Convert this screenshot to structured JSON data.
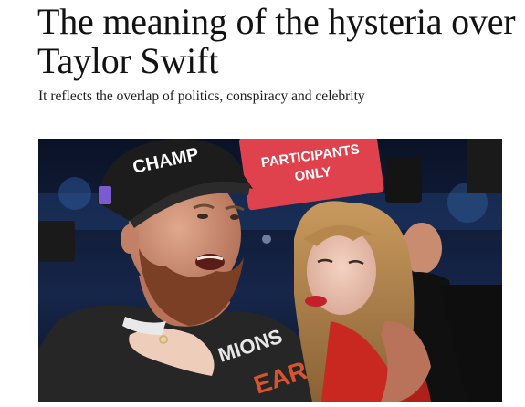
{
  "article": {
    "headline": "The meaning of the hysteria over Taylor Swift",
    "subheadline": "It reflects the overlap of politics, conspiracy and celebrity"
  },
  "photo": {
    "sign_text_line1": "PARTICIPANTS",
    "sign_text_line2": "ONLY",
    "cap_text": "CHAMP",
    "shirt_text_1": "MIONS",
    "shirt_text_2": "EAR",
    "sign_color": "#e0424d",
    "crowd_color": "#0f1d3a"
  }
}
